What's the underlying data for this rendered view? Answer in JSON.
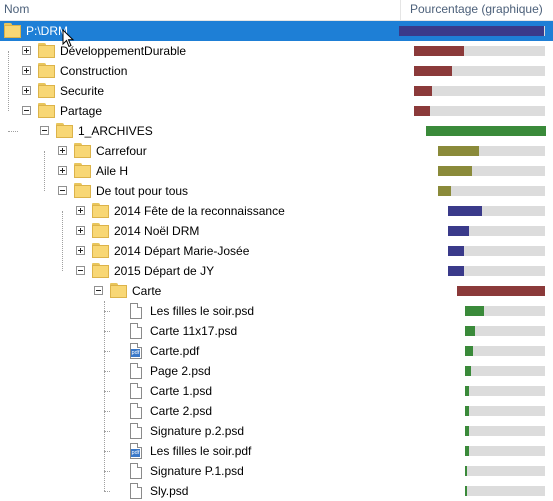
{
  "columns": {
    "name": "Nom",
    "percent": "Pourcentage (graphique)"
  },
  "colors": {
    "selection": "#1e7fd6",
    "level1": "#8b3a3a",
    "level2": "#3a8a3a",
    "level3": "#8a8a3a",
    "level4": "#3a3a8a",
    "track": "#dcdcdc"
  },
  "rows": [
    {
      "label": "P:\\DRM",
      "type": "folder",
      "toggle": "none",
      "selected": true,
      "percent": 0.99,
      "color": "#3a3a8a"
    },
    {
      "label": "DéveloppementDurable",
      "type": "folder",
      "toggle": "plus",
      "percent": 0.38,
      "color": "#8b3a3a"
    },
    {
      "label": "Construction",
      "type": "folder",
      "toggle": "plus",
      "percent": 0.29,
      "color": "#8b3a3a"
    },
    {
      "label": "Securite",
      "type": "folder",
      "toggle": "plus",
      "percent": 0.14,
      "color": "#8b3a3a"
    },
    {
      "label": "Partage",
      "type": "folder",
      "toggle": "minus",
      "percent": 0.12,
      "color": "#8b3a3a"
    },
    {
      "label": "1_ARCHIVES",
      "type": "folder",
      "toggle": "minus",
      "percent": 1.0,
      "color": "#3a8a3a"
    },
    {
      "label": "Carrefour",
      "type": "folder",
      "toggle": "plus",
      "percent": 0.38,
      "color": "#8a8a3a"
    },
    {
      "label": "Aile H",
      "type": "folder",
      "toggle": "plus",
      "percent": 0.32,
      "color": "#8a8a3a"
    },
    {
      "label": "De tout pour tous",
      "type": "folder",
      "toggle": "minus",
      "percent": 0.12,
      "color": "#8a8a3a"
    },
    {
      "label": "2014 Fête de la reconnaissance",
      "type": "folder",
      "toggle": "plus",
      "percent": 0.35,
      "color": "#3a3a8a"
    },
    {
      "label": "2014 Noël DRM",
      "type": "folder",
      "toggle": "plus",
      "percent": 0.22,
      "color": "#3a3a8a"
    },
    {
      "label": "2014 Départ Marie-Josée",
      "type": "folder",
      "toggle": "plus",
      "percent": 0.17,
      "color": "#3a3a8a"
    },
    {
      "label": "2015 Départ de JY",
      "type": "folder",
      "toggle": "minus",
      "percent": 0.17,
      "color": "#3a3a8a"
    },
    {
      "label": "Carte",
      "type": "folder",
      "toggle": "minus",
      "percent": 1.0,
      "color": "#8b3a3a"
    },
    {
      "label": "Les filles le soir.psd",
      "type": "file",
      "toggle": "none",
      "percent": 0.24,
      "color": "#3a8a3a"
    },
    {
      "label": "Carte 11x17.psd",
      "type": "file",
      "toggle": "none",
      "percent": 0.12,
      "color": "#3a8a3a"
    },
    {
      "label": "Carte.pdf",
      "type": "pdf",
      "toggle": "none",
      "percent": 0.1,
      "color": "#3a8a3a"
    },
    {
      "label": "Page 2.psd",
      "type": "file",
      "toggle": "none",
      "percent": 0.07,
      "color": "#3a8a3a"
    },
    {
      "label": "Carte 1.psd",
      "type": "file",
      "toggle": "none",
      "percent": 0.05,
      "color": "#3a8a3a"
    },
    {
      "label": "Carte 2.psd",
      "type": "file",
      "toggle": "none",
      "percent": 0.05,
      "color": "#3a8a3a"
    },
    {
      "label": "Signature p.2.psd",
      "type": "file",
      "toggle": "none",
      "percent": 0.05,
      "color": "#3a8a3a"
    },
    {
      "label": "Les filles le soir.pdf",
      "type": "pdf",
      "toggle": "none",
      "percent": 0.05,
      "color": "#3a8a3a"
    },
    {
      "label": "Signature P.1.psd",
      "type": "file",
      "toggle": "none",
      "percent": 0.02,
      "color": "#3a8a3a"
    },
    {
      "label": "Sly.psd",
      "type": "file",
      "toggle": "none",
      "percent": 0.02,
      "color": "#3a8a3a"
    }
  ]
}
